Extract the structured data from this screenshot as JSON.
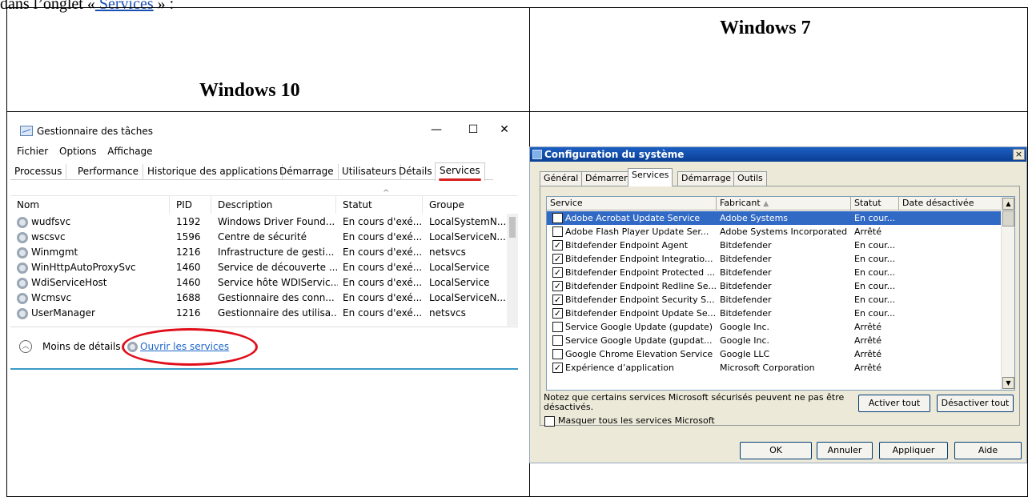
{
  "doc": {
    "intro_prefix": "dans l’onglet «",
    "intro_link": " Services",
    "intro_suffix": " » :",
    "col_win10": "Windows 10",
    "col_win7": "Windows 7"
  },
  "win10": {
    "title": "Gestionnaire des tâches",
    "window_buttons": {
      "minimize": "—",
      "maximize": "☐",
      "close": "✕"
    },
    "menu": [
      "Fichier",
      "Options",
      "Affichage"
    ],
    "tabs": [
      "Processus",
      "Performance",
      "Historique des applications",
      "Démarrage",
      "Utilisateurs",
      "Détails",
      "Services"
    ],
    "columns": [
      "Nom",
      "PID",
      "Description",
      "Statut",
      "Groupe"
    ],
    "sort_arrow": "^",
    "rows": [
      {
        "name": "wudfsvc",
        "pid": "1192",
        "description": "Windows Driver Found...",
        "status": "En cours d'exé...",
        "group": "LocalSystemN..."
      },
      {
        "name": "wscsvc",
        "pid": "1596",
        "description": "Centre de sécurité",
        "status": "En cours d'exé...",
        "group": "LocalServiceN..."
      },
      {
        "name": "Winmgmt",
        "pid": "1216",
        "description": "Infrastructure de gesti...",
        "status": "En cours d'exé...",
        "group": "netsvcs"
      },
      {
        "name": "WinHttpAutoProxySvc",
        "pid": "1460",
        "description": "Service de découverte ...",
        "status": "En cours d'exé...",
        "group": "LocalService"
      },
      {
        "name": "WdiServiceHost",
        "pid": "1460",
        "description": "Service hôte WDIServic...",
        "status": "En cours d'exé...",
        "group": "LocalService"
      },
      {
        "name": "Wcmsvc",
        "pid": "1688",
        "description": "Gestionnaire des conn...",
        "status": "En cours d'exé...",
        "group": "LocalServiceN..."
      },
      {
        "name": "UserManager",
        "pid": "1216",
        "description": "Gestionnaire des utilisa...",
        "status": "En cours d'exé...",
        "group": "netsvcs"
      }
    ],
    "less_details": "Moins de détails",
    "open_services": "Ouvrir les services",
    "accent_color": "#d81f1f"
  },
  "win7": {
    "title": "Configuration du système",
    "close": "×",
    "tabs": [
      "Général",
      "Démarrer",
      "Services",
      "Démarrage",
      "Outils"
    ],
    "columns": [
      "Service",
      "Fabricant",
      "Statut",
      "Date désactivée"
    ],
    "rows": [
      {
        "checked": false,
        "service": "Adobe Acrobat Update Service",
        "maker": "Adobe Systems",
        "status": "En cour...",
        "selected": true
      },
      {
        "checked": false,
        "service": "Adobe Flash Player Update Ser...",
        "maker": "Adobe Systems Incorporated",
        "status": "Arrêté"
      },
      {
        "checked": true,
        "service": "Bitdefender Endpoint Agent",
        "maker": "Bitdefender",
        "status": "En cour..."
      },
      {
        "checked": true,
        "service": "Bitdefender Endpoint Integratio...",
        "maker": "Bitdefender",
        "status": "En cour..."
      },
      {
        "checked": true,
        "service": "Bitdefender Endpoint Protected ...",
        "maker": "Bitdefender",
        "status": "En cour..."
      },
      {
        "checked": true,
        "service": "Bitdefender Endpoint Redline Se...",
        "maker": "Bitdefender",
        "status": "En cour..."
      },
      {
        "checked": true,
        "service": "Bitdefender Endpoint Security S...",
        "maker": "Bitdefender",
        "status": "En cour..."
      },
      {
        "checked": true,
        "service": "Bitdefender Endpoint Update Se...",
        "maker": "Bitdefender",
        "status": "En cour..."
      },
      {
        "checked": false,
        "service": "Service Google Update (gupdate)",
        "maker": "Google Inc.",
        "status": "Arrêté"
      },
      {
        "checked": false,
        "service": "Service Google Update (gupdat...",
        "maker": "Google Inc.",
        "status": "Arrêté"
      },
      {
        "checked": false,
        "service": "Google Chrome Elevation Service",
        "maker": "Google LLC",
        "status": "Arrêté"
      },
      {
        "checked": true,
        "service": "Expérience d’application",
        "maker": "Microsoft Corporation",
        "status": "Arrêté"
      }
    ],
    "note": "Notez que certains services Microsoft sécurisés peuvent ne pas être désactivés.",
    "enable_all": "Activer tout",
    "disable_all": "Désactiver tout",
    "hide_ms": "Masquer tous les services Microsoft",
    "ok": "OK",
    "cancel": "Annuler",
    "apply": "Appliquer",
    "help": "Aide",
    "selection_color": "#316ac5"
  }
}
